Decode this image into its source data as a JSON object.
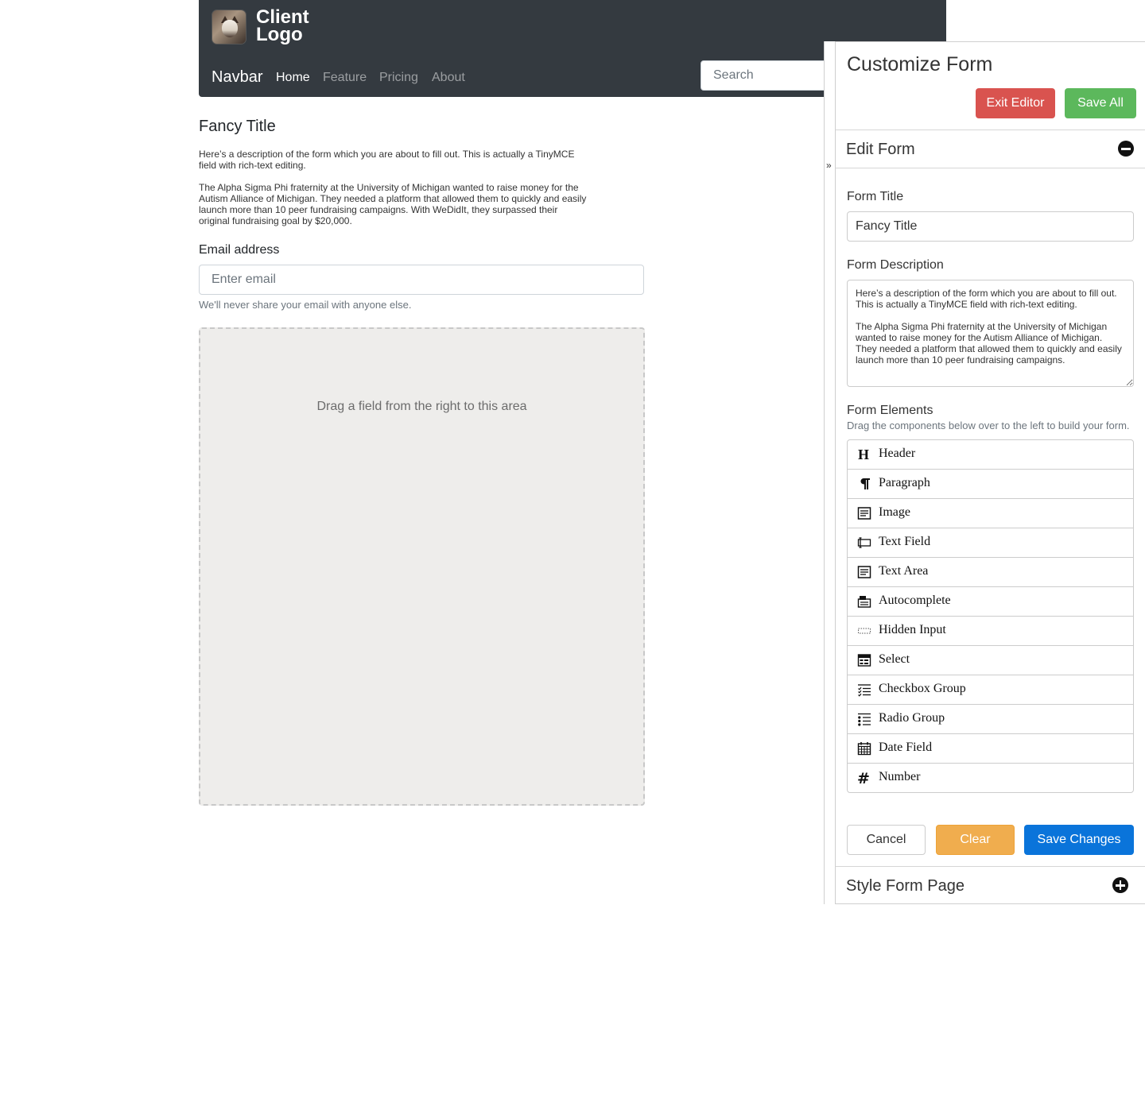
{
  "header": {
    "logo_text": "Client\nLogo",
    "brand": "Navbar",
    "nav": [
      "Home",
      "Feature",
      "Pricing",
      "About"
    ],
    "search_placeholder": "Search"
  },
  "form": {
    "title": "Fancy Title",
    "description_p1": "Here’s a description of the form which you are about to fill out. This is actually a TinyMCE field with rich-text editing.",
    "description_p2": "The Alpha Sigma Phi fraternity at the University of Michigan wanted to raise money for the Autism Alliance of Michigan. They needed a platform that allowed them to quickly and easily launch more than 10 peer fundraising campaigns. With WeDidIt, they surpassed their original fundraising goal by $20,000.",
    "email_label": "Email address",
    "email_placeholder": "Enter email",
    "email_help": "We'll never share your email with anyone else.",
    "drop_hint": "Drag a field from the right to this area"
  },
  "panel": {
    "toggle": "»",
    "title": "Customize Form",
    "exit_label": "Exit Editor",
    "save_all_label": "Save All",
    "edit_section_title": "Edit Form",
    "form_title_label": "Form Title",
    "form_title_value": "Fancy Title",
    "form_description_label": "Form Description",
    "form_description_value": "Here’s a description of the form which you are about to fill out. This is actually a TinyMCE field with rich-text editing.\n\nThe Alpha Sigma Phi fraternity at the University of Michigan wanted to raise money for the Autism Alliance of Michigan. They needed a platform that allowed them to quickly and easily launch more than 10 peer fundraising campaigns.",
    "form_elements_label": "Form Elements",
    "form_elements_hint": "Drag the components below over to the left to build your form.",
    "elements": [
      {
        "label": "Header",
        "icon": "header-icon"
      },
      {
        "label": "Paragraph",
        "icon": "paragraph-icon"
      },
      {
        "label": "Image",
        "icon": "image-icon"
      },
      {
        "label": "Text Field",
        "icon": "text-field-icon"
      },
      {
        "label": "Text Area",
        "icon": "text-area-icon"
      },
      {
        "label": "Autocomplete",
        "icon": "autocomplete-icon"
      },
      {
        "label": "Hidden Input",
        "icon": "hidden-input-icon"
      },
      {
        "label": "Select",
        "icon": "select-icon"
      },
      {
        "label": "Checkbox Group",
        "icon": "checkbox-group-icon"
      },
      {
        "label": "Radio Group",
        "icon": "radio-group-icon"
      },
      {
        "label": "Date Field",
        "icon": "date-field-icon"
      },
      {
        "label": "Number",
        "icon": "number-icon"
      }
    ],
    "cancel_label": "Cancel",
    "clear_label": "Clear",
    "save_changes_label": "Save Changes",
    "style_section_title": "Style Form Page"
  },
  "colors": {
    "navbar_bg": "#343a40",
    "exit": "#d9534f",
    "save_all": "#5cb85c",
    "clear": "#f0ad4e",
    "save_changes": "#0a74da",
    "drop_zone_bg": "#eeedeb"
  }
}
